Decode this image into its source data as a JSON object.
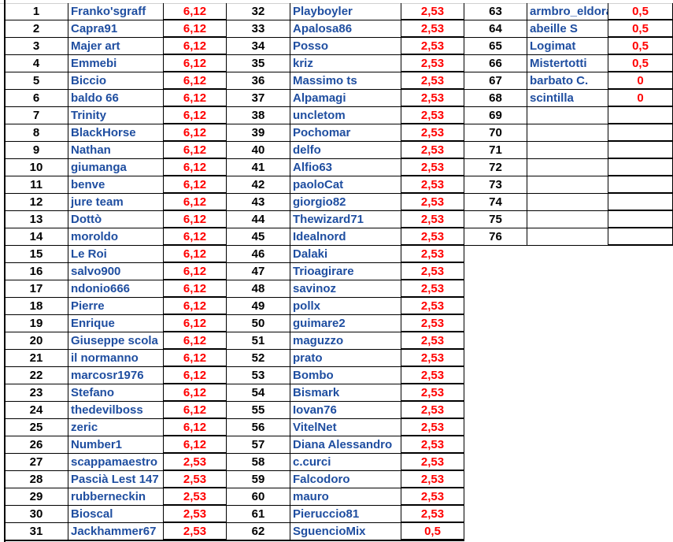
{
  "colors": {
    "name": "#1f4ea0",
    "value": "#ff0000",
    "number": "#000000"
  },
  "groups": [
    {
      "rows": [
        [
          "1",
          "Franko'sgraff",
          "6,12"
        ],
        [
          "2",
          "Capra91",
          "6,12"
        ],
        [
          "3",
          "Majer art",
          "6,12"
        ],
        [
          "4",
          "Emmebi",
          "6,12"
        ],
        [
          "5",
          "Biccio",
          "6,12"
        ],
        [
          "6",
          "baldo 66",
          "6,12"
        ],
        [
          "7",
          "Trinity",
          "6,12"
        ],
        [
          "8",
          "BlackHorse",
          "6,12"
        ],
        [
          "9",
          "Nathan",
          "6,12"
        ],
        [
          "10",
          "giumanga",
          "6,12"
        ],
        [
          "11",
          "benve",
          "6,12"
        ],
        [
          "12",
          "jure team",
          "6,12"
        ],
        [
          "13",
          "Dottò",
          "6,12"
        ],
        [
          "14",
          "moroldo",
          "6,12"
        ],
        [
          "15",
          "Le Roi",
          "6,12"
        ],
        [
          "16",
          "salvo900",
          "6,12"
        ],
        [
          "17",
          "ndonio666",
          "6,12"
        ],
        [
          "18",
          "Pierre",
          "6,12"
        ],
        [
          "19",
          "Enrique",
          "6,12"
        ],
        [
          "20",
          "Giuseppe scola",
          "6,12"
        ],
        [
          "21",
          "il normanno",
          "6,12"
        ],
        [
          "22",
          "marcosr1976",
          "6,12"
        ],
        [
          "23",
          "Stefano",
          "6,12"
        ],
        [
          "24",
          "thedevilboss",
          "6,12"
        ],
        [
          "25",
          "zeric",
          "6,12"
        ],
        [
          "26",
          "Number1",
          "6,12"
        ],
        [
          "27",
          "scappamaestro",
          "2,53"
        ],
        [
          "28",
          "Pascià Lest 147",
          "2,53"
        ],
        [
          "29",
          "rubberneckin",
          "2,53"
        ],
        [
          "30",
          "Bioscal",
          "2,53"
        ],
        [
          "31",
          "Jackhammer67",
          "2,53"
        ]
      ]
    },
    {
      "rows": [
        [
          "32",
          "Playboyler",
          "2,53"
        ],
        [
          "33",
          "Apalosa86",
          "2,53"
        ],
        [
          "34",
          "Posso",
          "2,53"
        ],
        [
          "35",
          "kriz",
          "2,53"
        ],
        [
          "36",
          "Massimo ts",
          "2,53"
        ],
        [
          "37",
          "Alpamagi",
          "2,53"
        ],
        [
          "38",
          "uncletom",
          "2,53"
        ],
        [
          "39",
          "Pochomar",
          "2,53"
        ],
        [
          "40",
          "delfo",
          "2,53"
        ],
        [
          "41",
          "Alfio63",
          "2,53"
        ],
        [
          "42",
          "paoloCat",
          "2,53"
        ],
        [
          "43",
          "giorgio82",
          "2,53"
        ],
        [
          "44",
          "Thewizard71",
          "2,53"
        ],
        [
          "45",
          "Idealnord",
          "2,53"
        ],
        [
          "46",
          "Dalaki",
          "2,53"
        ],
        [
          "47",
          "Trioagirare",
          "2,53"
        ],
        [
          "48",
          "savinoz",
          "2,53"
        ],
        [
          "49",
          "pollx",
          "2,53"
        ],
        [
          "50",
          "guimare2",
          "2,53"
        ],
        [
          "51",
          "maguzzo",
          "2,53"
        ],
        [
          "52",
          "prato",
          "2,53"
        ],
        [
          "53",
          "Bombo",
          "2,53"
        ],
        [
          "54",
          "Bismark",
          "2,53"
        ],
        [
          "55",
          "Iovan76",
          "2,53"
        ],
        [
          "56",
          "VitelNet",
          "2,53"
        ],
        [
          "57",
          "Diana Alessandro",
          "2,53"
        ],
        [
          "58",
          "c.curci",
          "2,53"
        ],
        [
          "59",
          "Falcodoro",
          "2,53"
        ],
        [
          "60",
          "mauro",
          "2,53"
        ],
        [
          "61",
          "Pieruccio81",
          "2,53"
        ],
        [
          "62",
          "SguencioMix",
          "0,5"
        ]
      ]
    },
    {
      "rows": [
        [
          "63",
          "armbro_eldorado",
          "0,5"
        ],
        [
          "64",
          "abeille S",
          "0,5"
        ],
        [
          "65",
          "Logimat",
          "0,5"
        ],
        [
          "66",
          "Mistertotti",
          "0,5"
        ],
        [
          "67",
          "barbato C.",
          "0"
        ],
        [
          "68",
          "scintilla",
          "0"
        ],
        [
          "69",
          "",
          ""
        ],
        [
          "70",
          "",
          ""
        ],
        [
          "71",
          "",
          ""
        ],
        [
          "72",
          "",
          ""
        ],
        [
          "73",
          "",
          ""
        ],
        [
          "74",
          "",
          ""
        ],
        [
          "75",
          "",
          ""
        ],
        [
          "76",
          "",
          ""
        ]
      ]
    }
  ]
}
